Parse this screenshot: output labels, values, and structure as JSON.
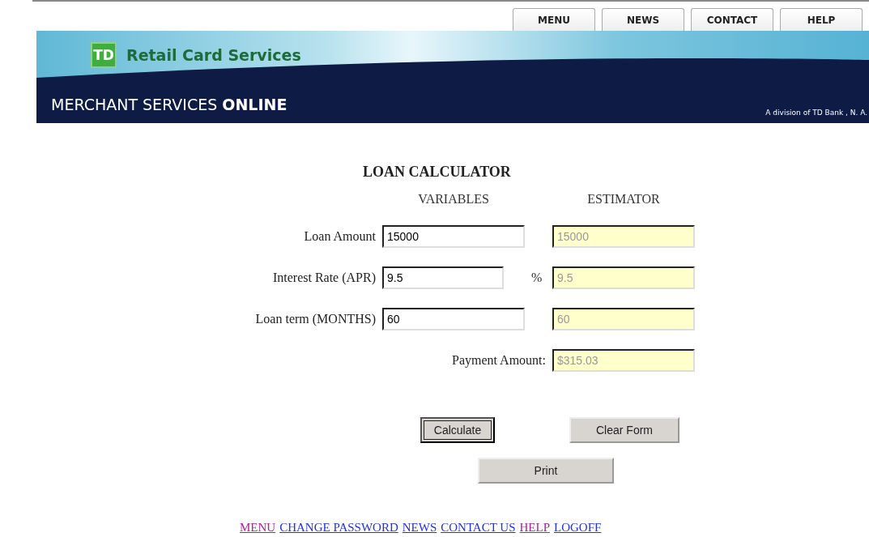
{
  "top_tabs": [
    {
      "label": "MENU"
    },
    {
      "label": "NEWS"
    },
    {
      "label": "CONTACT"
    },
    {
      "label": "HELP"
    }
  ],
  "banner": {
    "logo_text": "TD",
    "brand": "Retail Card Services",
    "product": "MERCHANT SERVICES ",
    "product_bold": "ONLINE",
    "division": "A division of TD Bank , N. A."
  },
  "calculator": {
    "title": "LOAN CALCULATOR",
    "column_headers": [
      "VARIABLES",
      "ESTIMATOR"
    ],
    "rows": [
      {
        "label": "Loan Amount",
        "value": "15000",
        "unit": "",
        "estimate": "15000"
      },
      {
        "label": "Interest Rate (APR)",
        "value": "9.5",
        "unit": "%",
        "estimate": "9.5"
      },
      {
        "label": "Loan term (MONTHS)",
        "value": "60",
        "unit": "",
        "estimate": "60"
      }
    ],
    "payment": {
      "label": "Payment Amount:",
      "value": "$315.03"
    },
    "buttons": [
      {
        "label": "Calculate",
        "focused": true
      },
      {
        "label": "Clear Form",
        "focused": false
      }
    ],
    "print_button": {
      "label": "Print",
      "focused": false
    }
  },
  "footer_links": [
    {
      "label": "MENU",
      "visited": true
    },
    {
      "label": "CHANGE PASSWORD",
      "visited": false
    },
    {
      "label": "NEWS",
      "visited": false
    },
    {
      "label": "CONTACT US",
      "visited": false
    },
    {
      "label": "HELP",
      "visited": true
    },
    {
      "label": "LOGOFF",
      "visited": false
    }
  ]
}
